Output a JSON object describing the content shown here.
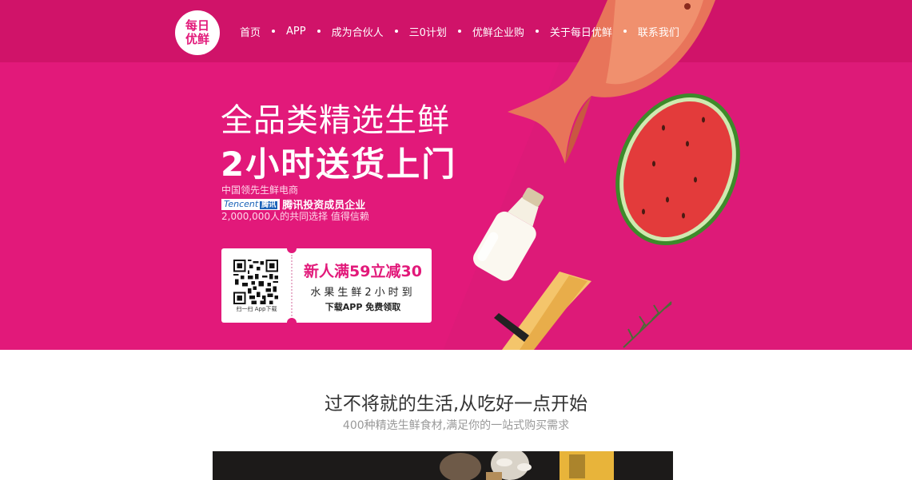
{
  "brand": {
    "logo_line1": "每日",
    "logo_line2": "优鲜"
  },
  "nav": {
    "items": [
      {
        "label": "首页"
      },
      {
        "label": "APP"
      },
      {
        "label": "成为合伙人"
      },
      {
        "label": "三0计划"
      },
      {
        "label": "优鲜企业购"
      },
      {
        "label": "关于每日优鲜"
      },
      {
        "label": "联系我们"
      }
    ]
  },
  "hero": {
    "headline1": "全品类精选生鲜",
    "headline2": "2小时送货上门",
    "subtitle1": "中国领先生鲜电商",
    "tencent_logo_text": "Tencent",
    "tencent_logo_cn": "腾讯",
    "tencent_text": "腾讯投资成员企业",
    "subtitle3": "2,000,000人的共同选择  值得信赖"
  },
  "coupon": {
    "qr_caption": "扫一扫 App下载",
    "line1": "新人满59立减30",
    "line2": "水果生鲜2小时到",
    "line3": "下载APP 免费领取"
  },
  "section": {
    "title": "过不将就的生活,从吃好一点开始",
    "subtitle": "400种精选生鲜食材,满足你的一站式购买需求"
  },
  "colors": {
    "brand": "#e2197a",
    "header_band": "#d01369"
  }
}
